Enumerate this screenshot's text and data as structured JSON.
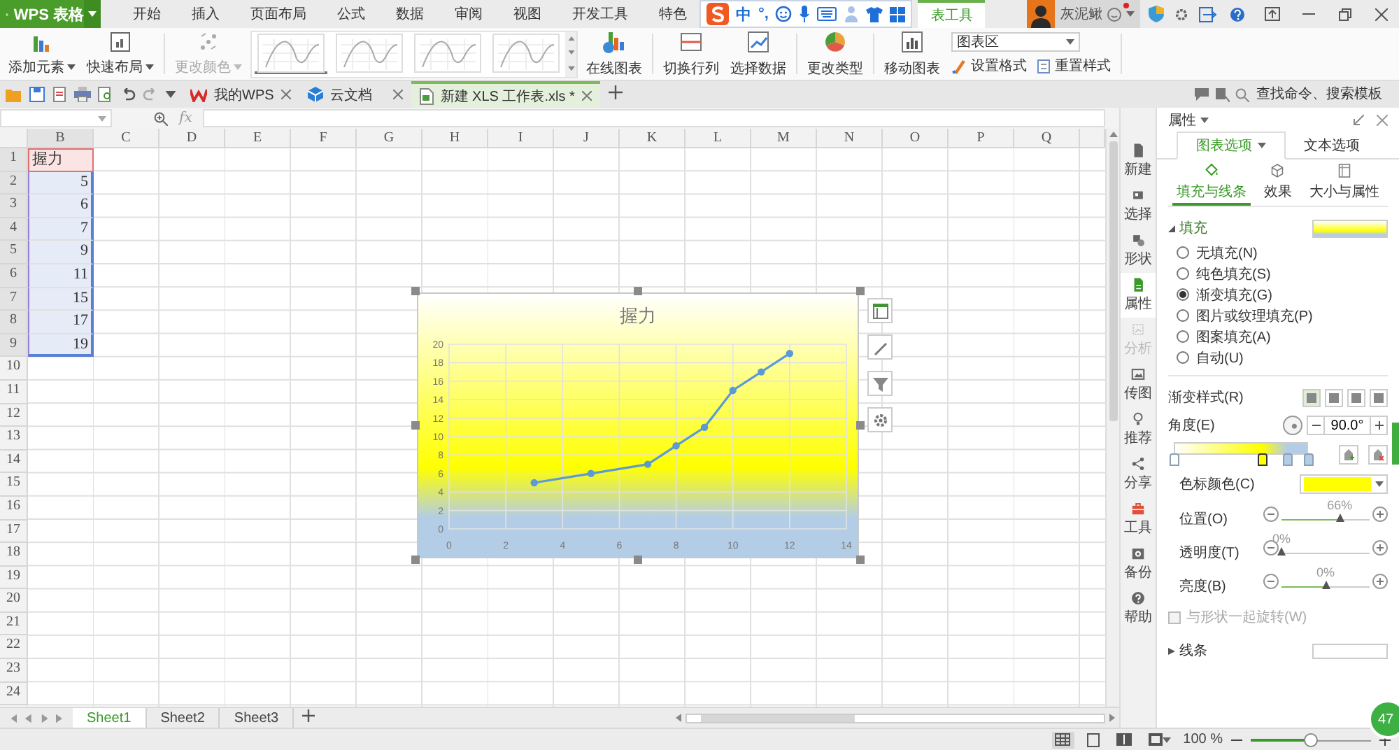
{
  "app": {
    "logo": "WPS 表格"
  },
  "menu_tabs": [
    {
      "label": "开始",
      "selected": false
    },
    {
      "label": "插入",
      "selected": false
    },
    {
      "label": "页面布局",
      "selected": false
    },
    {
      "label": "公式",
      "selected": false
    },
    {
      "label": "数据",
      "selected": false
    },
    {
      "label": "审阅",
      "selected": false
    },
    {
      "label": "视图",
      "selected": false
    },
    {
      "label": "开发工具",
      "selected": false
    },
    {
      "label": "特色",
      "selected": false
    }
  ],
  "ime_bar": {
    "mode": "中",
    "punctuation": "°,"
  },
  "context_tab": {
    "label": "表工具",
    "selected": true
  },
  "user": {
    "name": "灰泥鳅",
    "notification": true
  },
  "ribbon": {
    "main_buttons": [
      {
        "label": "添加元素",
        "disabled": false
      },
      {
        "label": "快速布局",
        "disabled": false
      },
      {
        "label": "更改颜色",
        "disabled": true
      }
    ],
    "styles": [
      {
        "selected": true
      },
      {
        "selected": false
      },
      {
        "selected": false
      },
      {
        "selected": false
      }
    ],
    "chart_buttons": [
      {
        "label": "在线图表"
      },
      {
        "label": "切换行列"
      },
      {
        "label": "选择数据"
      },
      {
        "label": "更改类型"
      },
      {
        "label": "移动图表"
      }
    ],
    "element_select": {
      "value": "图表区"
    },
    "format_buttons": [
      {
        "label": "设置格式"
      },
      {
        "label": "重置样式"
      }
    ]
  },
  "doc_tabs": [
    {
      "label": "我的WPS",
      "selected": false
    },
    {
      "label": "云文档",
      "selected": false
    },
    {
      "label": "新建 XLS 工作表.xls *",
      "selected": true
    }
  ],
  "search": {
    "placeholder": "查找命令、搜索模板"
  },
  "formula_bar": {
    "fx_label": "fx"
  },
  "sheet": {
    "columns": [
      "B",
      "C",
      "D",
      "E",
      "F",
      "G",
      "H",
      "I",
      "J",
      "K",
      "L",
      "M",
      "N",
      "O",
      "P",
      "Q"
    ],
    "rows": [
      {
        "number": "1",
        "value": "握力",
        "kind": "label",
        "selected": true
      },
      {
        "number": "2",
        "value": "5",
        "kind": "number",
        "selected": true
      },
      {
        "number": "3",
        "value": "6",
        "kind": "number",
        "selected": true
      },
      {
        "number": "4",
        "value": "7",
        "kind": "number",
        "selected": true
      },
      {
        "number": "5",
        "value": "9",
        "kind": "number",
        "selected": true
      },
      {
        "number": "6",
        "value": "11",
        "kind": "number",
        "selected": true
      },
      {
        "number": "7",
        "value": "15",
        "kind": "number",
        "selected": true
      },
      {
        "number": "8",
        "value": "17",
        "kind": "number",
        "selected": true
      },
      {
        "number": "9",
        "value": "19",
        "kind": "number",
        "selected": true
      },
      {
        "number": "10",
        "selected": false
      },
      {
        "number": "11",
        "selected": false
      },
      {
        "number": "12",
        "selected": false
      },
      {
        "number": "13",
        "selected": false
      },
      {
        "number": "14",
        "selected": false
      },
      {
        "number": "15",
        "selected": false
      },
      {
        "number": "16",
        "selected": false
      },
      {
        "number": "17",
        "selected": false
      },
      {
        "number": "18",
        "selected": false
      },
      {
        "number": "19",
        "selected": false
      },
      {
        "number": "20",
        "selected": false
      },
      {
        "number": "21",
        "selected": false
      },
      {
        "number": "22",
        "selected": false
      },
      {
        "number": "23",
        "selected": false
      },
      {
        "number": "24",
        "selected": false
      }
    ]
  },
  "chart": {
    "chart_data": {
      "type": "line",
      "title": "握力",
      "x": [
        3,
        5,
        7,
        8,
        9,
        10,
        11,
        12
      ],
      "series": [
        {
          "color": "#5b9bd5",
          "marker": "circle",
          "values": [
            5,
            6,
            7,
            9,
            11,
            15,
            17,
            19
          ]
        }
      ],
      "grid": true,
      "xlim": [
        0,
        14
      ],
      "ylim": [
        0,
        20
      ],
      "xticks": [
        0,
        2,
        4,
        6,
        8,
        10,
        12,
        14
      ],
      "yticks": [
        0,
        2,
        4,
        6,
        8,
        10,
        12,
        14,
        16,
        18,
        20
      ]
    }
  },
  "side_nav": [
    {
      "label": "新建",
      "selected": false,
      "disabled": false
    },
    {
      "label": "选择",
      "selected": false,
      "disabled": false
    },
    {
      "label": "形状",
      "selected": false,
      "disabled": false
    },
    {
      "label": "属性",
      "selected": true,
      "disabled": false
    },
    {
      "label": "分析",
      "selected": false,
      "disabled": true
    },
    {
      "label": "传图",
      "selected": false,
      "disabled": false
    },
    {
      "label": "推荐",
      "selected": false,
      "disabled": false
    },
    {
      "label": "分享",
      "selected": false,
      "disabled": false
    },
    {
      "label": "工具",
      "selected": false,
      "disabled": false
    },
    {
      "label": "备份",
      "selected": false,
      "disabled": false
    },
    {
      "label": "帮助",
      "selected": false,
      "disabled": false
    }
  ],
  "panel": {
    "title": "属性",
    "tabs": [
      {
        "label": "图表选项",
        "selected": true
      },
      {
        "label": "文本选项",
        "selected": false
      }
    ],
    "subtabs": [
      {
        "label": "填充与线条",
        "selected": true
      },
      {
        "label": "效果",
        "selected": false
      },
      {
        "label": "大小与属性",
        "selected": false
      }
    ],
    "fill": {
      "title": "填充",
      "expanded": true,
      "options": [
        {
          "label": "无填充(N)",
          "selected": false
        },
        {
          "label": "纯色填充(S)",
          "selected": false
        },
        {
          "label": "渐变填充(G)",
          "selected": true
        },
        {
          "label": "图片或纹理填充(P)",
          "selected": false
        },
        {
          "label": "图案填充(A)",
          "selected": false
        },
        {
          "label": "自动(U)",
          "selected": false
        }
      ]
    },
    "gradient": {
      "style_label": "渐变样式(R)",
      "styles": [
        {
          "selected": true
        },
        {
          "selected": false
        },
        {
          "selected": false
        },
        {
          "selected": false
        }
      ],
      "angle_label": "角度(E)",
      "angle": "90.0°",
      "stops": [
        {
          "level": 0,
          "color": "#ffffff",
          "selected": false
        },
        {
          "level": 0.66,
          "color": "#ffff00",
          "selected": true
        },
        {
          "level": 0.85,
          "color": "#b4cde6",
          "selected": false
        },
        {
          "level": 1,
          "color": "#b4cde6",
          "selected": false
        }
      ],
      "stop_color_label": "色标颜色(C)"
    },
    "sliders": [
      {
        "label": "位置(O)",
        "reading": "66%",
        "level": 0.66
      },
      {
        "label": "透明度(T)",
        "reading": "0%",
        "level": 0
      },
      {
        "label": "亮度(B)",
        "reading": "0%",
        "level": 0.5
      }
    ],
    "rotate": {
      "label": "与形状一起旋转(W)",
      "checked": false,
      "disabled": true
    },
    "line": {
      "title": "线条",
      "expanded": false
    }
  },
  "sheet_tabs": [
    {
      "label": "Sheet1",
      "selected": true
    },
    {
      "label": "Sheet2",
      "selected": false
    },
    {
      "label": "Sheet3",
      "selected": false
    }
  ],
  "status": {
    "zoom": "100 %",
    "zoom_slider": {
      "level": 0.5
    }
  },
  "badge": "47"
}
